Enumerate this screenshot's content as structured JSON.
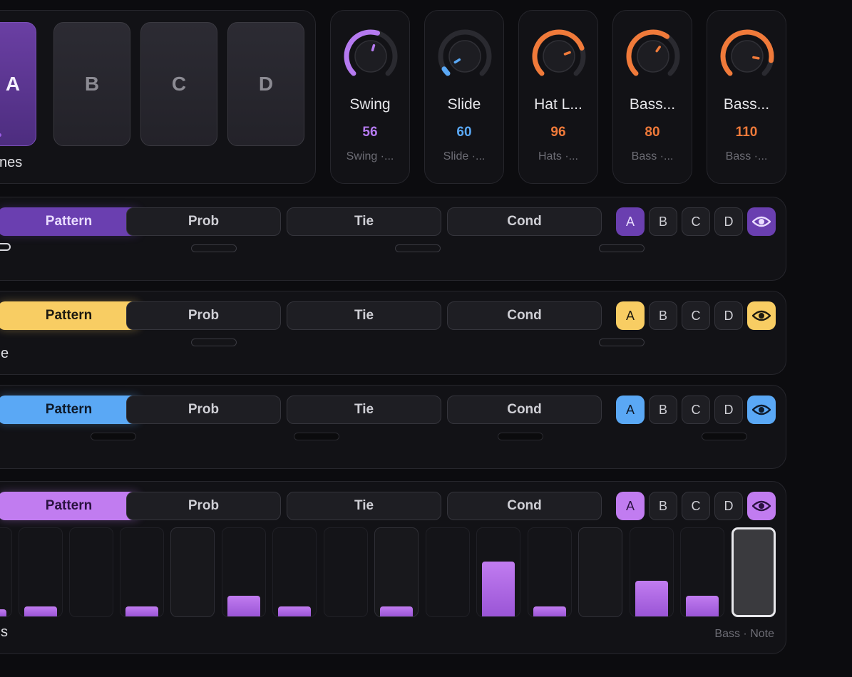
{
  "scenes": {
    "buttons": [
      "A",
      "B",
      "C",
      "D"
    ],
    "active": "A",
    "label": "nes"
  },
  "knobs": [
    {
      "name": "Swing",
      "value": "56",
      "sub": "Swing ·...",
      "color": "#b57af0",
      "fraction": 0.56
    },
    {
      "name": "Slide",
      "value": "60",
      "sub": "Slide ·...",
      "color": "#5aa8f5",
      "fraction": 0.05
    },
    {
      "name": "Hat L...",
      "value": "96",
      "sub": "Hats ·...",
      "color": "#f07a3a",
      "fraction": 0.76
    },
    {
      "name": "Bass...",
      "value": "80",
      "sub": "Bass ·...",
      "color": "#f07a3a",
      "fraction": 0.63
    },
    {
      "name": "Bass...",
      "value": "110",
      "sub": "Bass ·...",
      "color": "#f07a3a",
      "fraction": 0.87
    }
  ],
  "lanes": [
    {
      "accent": "#6a3fb0",
      "accent_text": "#e9dcff",
      "label": "",
      "modes": [
        "Pattern",
        "Prob",
        "Tie",
        "Cond"
      ],
      "selectors": [
        "A",
        "B",
        "C",
        "D"
      ],
      "active_selector": "A"
    },
    {
      "accent": "#f8cd63",
      "accent_text": "#1d1a10",
      "label": "e",
      "modes": [
        "Pattern",
        "Prob",
        "Tie",
        "Cond"
      ],
      "selectors": [
        "A",
        "B",
        "C",
        "D"
      ],
      "active_selector": "A"
    },
    {
      "accent": "#5aa8f5",
      "accent_text": "#0e1a2a",
      "label": "",
      "modes": [
        "Pattern",
        "Prob",
        "Tie",
        "Cond"
      ],
      "selectors": [
        "A",
        "B",
        "C",
        "D"
      ],
      "active_selector": "A"
    },
    {
      "accent": "#c17cf0",
      "accent_text": "#2a1240",
      "label": "s",
      "modes": [
        "Pattern",
        "Prob",
        "Tie",
        "Cond"
      ],
      "selectors": [
        "A",
        "B",
        "C",
        "D"
      ],
      "active_selector": "A",
      "footer": "Bass · Note",
      "steps": [
        0.08,
        0.12,
        0,
        0.12,
        0,
        0.24,
        0.12,
        0,
        0.12,
        0,
        0.64,
        0.12,
        0,
        0.42,
        0.24,
        0
      ]
    }
  ],
  "icons": {
    "eye": "eye-icon"
  }
}
